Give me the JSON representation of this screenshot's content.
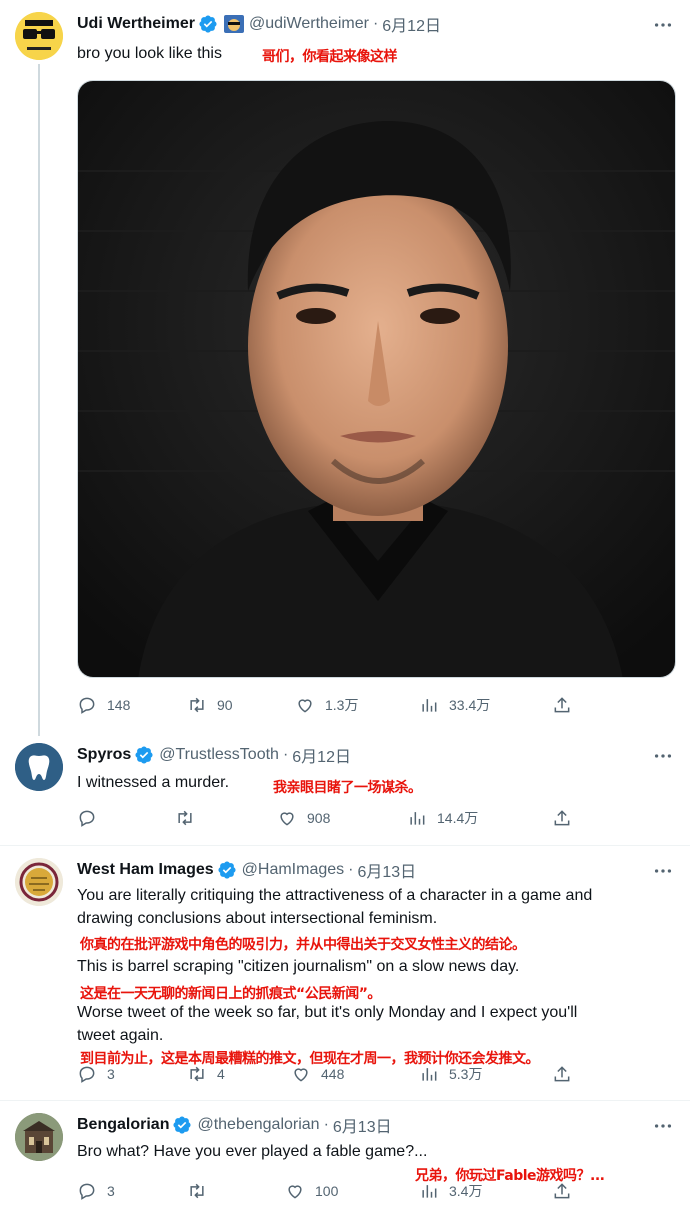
{
  "tweets": [
    {
      "name": "Udi Wertheimer",
      "handle": "@udiWertheimer",
      "date": "6月12日",
      "text": "bro you look like this",
      "translation": "哥们，你看起来像这样",
      "replies": "148",
      "retweets": "90",
      "likes": "1.3万",
      "views": "33.4万"
    },
    {
      "name": "Spyros",
      "handle": "@TrustlessTooth",
      "date": "6月12日",
      "text": "I witnessed a murder.",
      "translation": "我亲眼目睹了一场谋杀。",
      "replies": "",
      "retweets": "",
      "likes": "908",
      "views": "14.4万"
    },
    {
      "name": "West Ham Images",
      "handle": "@HamImages",
      "date": "6月13日",
      "text_line1": "You are literally critiquing the attractiveness of a character in a game and",
      "text_line2": "drawing conclusions about intersectional feminism.",
      "translation1": "你真的在批评游戏中角色的吸引力，并从中得出关于交叉女性主义的结论。",
      "text_line3": "This is barrel scraping \"citizen journalism\" on a slow news day.",
      "translation2": "这是在一天无聊的新闻日上的抓痕式“公民新闻”。",
      "text_line4": "Worse tweet of the week so far, but it's only Monday and I expect you'll",
      "text_line5": "tweet again.",
      "translation3": "到目前为止，这是本周最糟糕的推文，但现在才周一，我预计你还会发推文。",
      "replies": "3",
      "retweets": "4",
      "likes": "448",
      "views": "5.3万"
    },
    {
      "name": "Bengalorian",
      "handle": "@thebengalorian",
      "date": "6月13日",
      "text": "Bro what? Have you ever played a fable game?...",
      "translation": "兄弟，你玩过Fable游戏吗？...",
      "replies": "3",
      "retweets": "",
      "likes": "100",
      "views": "3.4万"
    }
  ],
  "dot": "·",
  "colors": {
    "verified": "#1d9bf0",
    "translation": "#e8140c",
    "muted": "#536471"
  }
}
